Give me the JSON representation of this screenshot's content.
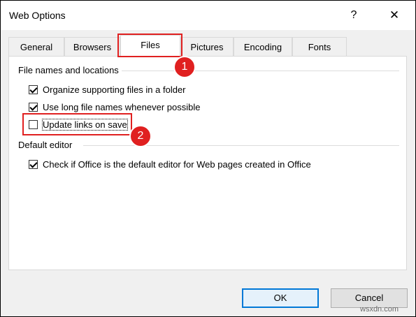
{
  "dialog": {
    "title": "Web Options",
    "help_symbol": "?",
    "close_symbol": "✕"
  },
  "tabs": [
    "General",
    "Browsers",
    "Files",
    "Pictures",
    "Encoding",
    "Fonts"
  ],
  "active_tab": "Files",
  "sections": {
    "file_names": {
      "label": "File names and locations",
      "options": [
        {
          "label": "Organize supporting files in a folder",
          "checked": true
        },
        {
          "label": "Use long file names whenever possible",
          "checked": true
        },
        {
          "label": "Update links on save",
          "checked": false
        }
      ]
    },
    "default_editor": {
      "label": "Default editor",
      "options": [
        {
          "label": "Check if Office is the default editor for Web pages created in Office",
          "checked": true
        }
      ]
    }
  },
  "annotations": {
    "step1": "1",
    "step2": "2",
    "color": "#e02020"
  },
  "buttons": {
    "ok": "OK",
    "cancel": "Cancel"
  },
  "watermark": "wsxdn.com"
}
